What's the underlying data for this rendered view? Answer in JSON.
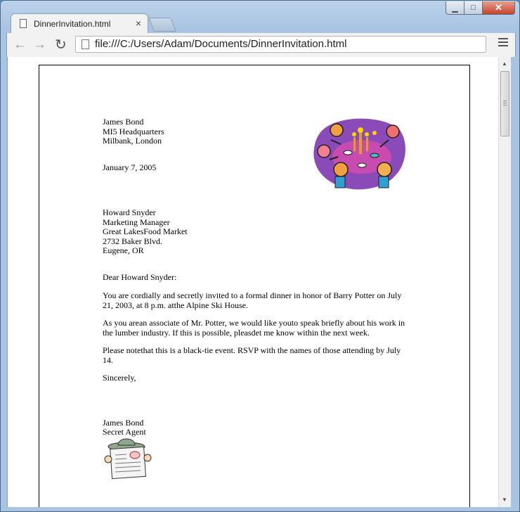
{
  "tab": {
    "title": "DinnerInvitation.html",
    "close": "×"
  },
  "window": {
    "minimize": "▁",
    "maximize": "□",
    "close": "✕"
  },
  "toolbar": {
    "back": "←",
    "forward": "→",
    "reload": "↻",
    "url": "file:///C:/Users/Adam/Documents/DinnerInvitation.html"
  },
  "letter": {
    "sender_name": "James Bond",
    "sender_org": "MI5 Headquarters",
    "sender_location": "Milbank, London",
    "date": "January 7, 2005",
    "recipient_name": "Howard Snyder",
    "recipient_title": "Marketing Manager",
    "recipient_company": "Great LakesFood Market",
    "recipient_street": "2732 Baker Blvd.",
    "recipient_city": "Eugene, OR",
    "greeting": "Dear Howard Snyder:",
    "paragraph1": "You are cordially and secretly invited to a formal dinner in honor of Barry Potter on July 21, 2003, at 8 p.m. atthe Alpine Ski House.",
    "paragraph2": "As you arean associate of Mr. Potter, we would like youto speak briefly about his work in the lumber industry. If this is possible, pleasdet me know within the next week.",
    "paragraph3": "Please notethat this is a black-tie event. RSVP with the names of those attending by July 14.",
    "closing": "Sincerely,",
    "signature_name": "James Bond",
    "signature_title": "Secret Agent"
  },
  "images": {
    "party": "dinner-party-clipart",
    "reader": "newspaper-reader-clipart"
  },
  "colors": {
    "party_blob": "#8a4bb8",
    "tablecloth": "#c84bb0",
    "reader_hat": "#8fa88a"
  }
}
